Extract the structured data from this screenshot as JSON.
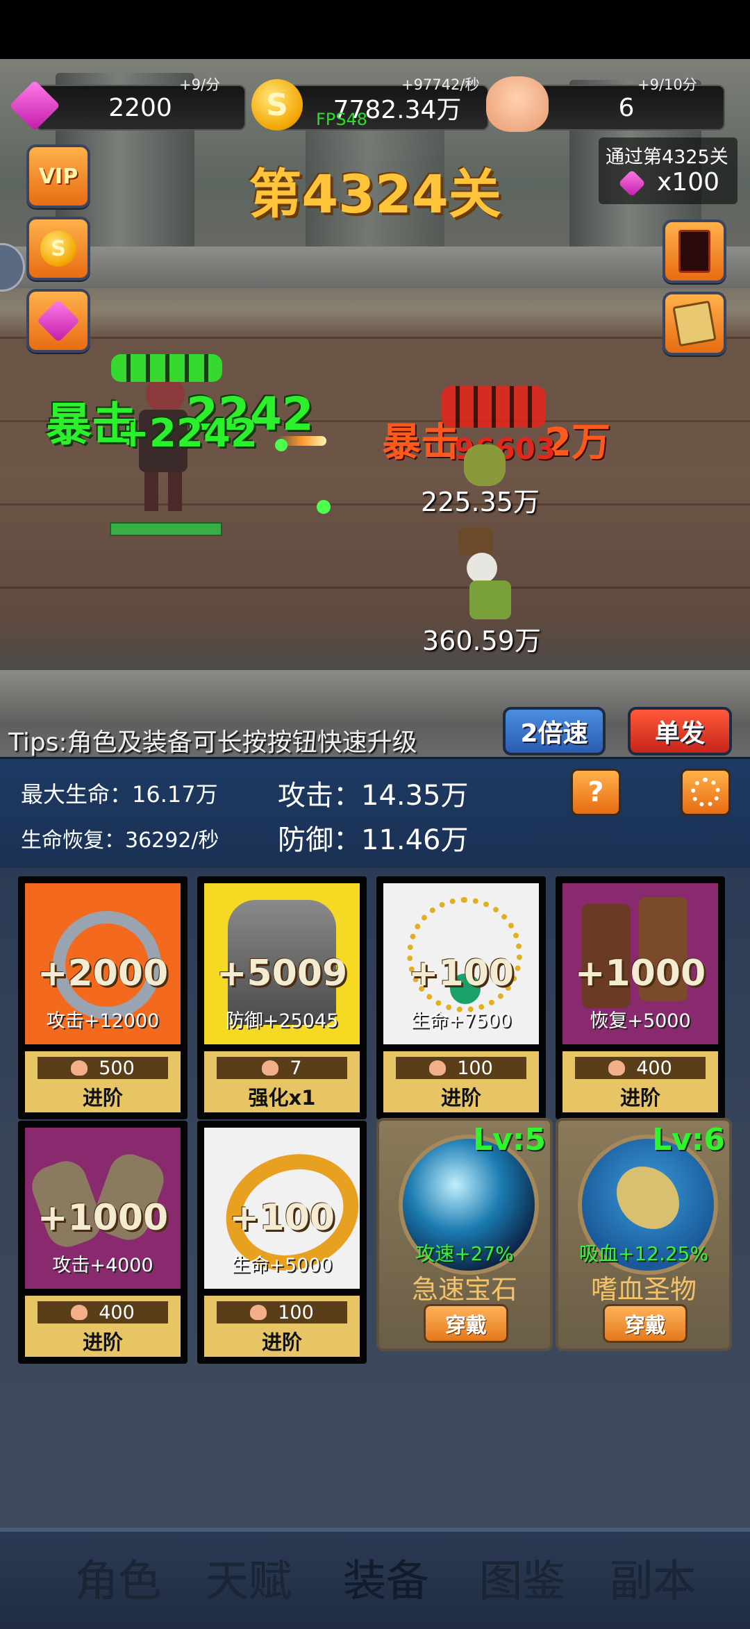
{
  "resources": {
    "gems": {
      "value": "2200",
      "rate": "+9/分"
    },
    "gold": {
      "value": "7782.34万",
      "rate": "+97742/秒"
    },
    "skulls": {
      "value": "6",
      "rate": "+9/10分"
    },
    "fps": "FPS48"
  },
  "stage": {
    "title": "第4324关",
    "next_reward_label": "通过第4325关",
    "next_reward_amount": "x100"
  },
  "side_buttons": {
    "vip_label": "VIP"
  },
  "battle": {
    "hero_crit_label": "暴击",
    "hero_damage": "2242",
    "hero_damage_popup": "+2242",
    "enemy_crit_label": "暴击",
    "enemy_crit_value": "2万",
    "enemy_damage": "96603",
    "enemy1_hp": "225.35万",
    "enemy2_hp": "360.59万"
  },
  "tips": "Tips:角色及装备可长按按钮快速升级",
  "speed_button": "2倍速",
  "fire_mode_button": "单发",
  "stats": {
    "max_hp": "最大生命：16.17万",
    "regen": "生命恢复：36292/秒",
    "attack": "攻击：14.35万",
    "defense": "防御：11.46万",
    "help_label": "?"
  },
  "equipment": [
    {
      "name": "weapon",
      "level": "+2000",
      "bonus": "攻击+12000",
      "cost": "500",
      "action": "进阶",
      "color": "#f36a1e"
    },
    {
      "name": "armor",
      "level": "+5009",
      "bonus": "防御+25045",
      "cost": "7",
      "action": "强化x1",
      "color": "#f6d923"
    },
    {
      "name": "necklace",
      "level": "+100",
      "bonus": "生命+7500",
      "cost": "100",
      "action": "进阶",
      "color": "#f1f1f1"
    },
    {
      "name": "boots",
      "level": "+1000",
      "bonus": "恢复+5000",
      "cost": "400",
      "action": "进阶",
      "color": "#8a2a6e"
    },
    {
      "name": "gloves",
      "level": "+1000",
      "bonus": "攻击+4000",
      "cost": "400",
      "action": "进阶",
      "color": "#8a2a6e"
    },
    {
      "name": "ring",
      "level": "+100",
      "bonus": "生命+5000",
      "cost": "100",
      "action": "进阶",
      "color": "#f1f1f1"
    }
  ],
  "relics": [
    {
      "name": "急速宝石",
      "lv": "Lv:5",
      "buff": "攻速+27%",
      "button": "穿戴"
    },
    {
      "name": "嗜血圣物",
      "lv": "Lv:6",
      "buff": "吸血+12.25%",
      "button": "穿戴"
    }
  ],
  "nav": [
    "角色",
    "天赋",
    "装备",
    "图鉴",
    "副本"
  ],
  "nav_active_index": 2
}
